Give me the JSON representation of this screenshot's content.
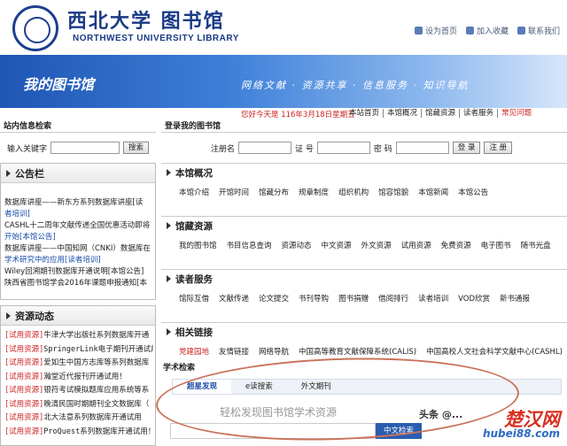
{
  "header": {
    "logo_cn": "西北大学 图书馆",
    "logo_en": "NORTHWEST UNIVERSITY LIBRARY",
    "top_links": [
      "设为首页",
      "加入收藏",
      "联系我们"
    ]
  },
  "banner": {
    "title": "我的图书馆",
    "slogan": "网络文献 · 资源共享 · 信息服务 · 知识导航"
  },
  "topnav": {
    "date": "您好今天是 116年3月18日星期五",
    "items": [
      "本站首页",
      "本馆概况",
      "馆藏资源",
      "读者服务",
      "常见问题"
    ]
  },
  "site_search": {
    "title": "站内信息检索",
    "label": "输入关键字",
    "button": "搜索"
  },
  "notice": {
    "title": "公告栏",
    "items": [
      "数据库讲座——新东方系列数据库讲座[读",
      "者培训]",
      "CASHL十二周年文献传递全国优惠活动即将",
      "开始[本馆公告]",
      "数据库讲座——中国知网（CNKI）数据库在",
      "学术研究中的应用[读者培训]",
      "Wiley回溯期刊数据库开通说明[本馆公告]",
      "陕西省图书馆学会2016年课题申报通知[本"
    ]
  },
  "resources": {
    "title": "资源动态",
    "tag": "[试用资源]",
    "items": [
      "牛津大学出版社系列数据库开通",
      "SpringerLink电子期刊开通试用",
      "爱如生中国方志库等系列数据库",
      "瀚堂近代报刊开通试用！",
      "银符考试模拟题库应用系统等系",
      "晚清民国时期期刊全文数据库（",
      "北大法意系列数据库开通试用",
      "ProQuest系列数据库开通试用！"
    ]
  },
  "login": {
    "title": "登录我的图书馆",
    "username": "注册名",
    "id": "证  号",
    "password": "密  码",
    "login_btn": "登 录",
    "register_btn": "注 册"
  },
  "sections": [
    {
      "title": "本馆概况",
      "items": [
        "本馆介绍",
        "开馆时间",
        "馆藏分布",
        "规章制度",
        "组织机构",
        "馆容馆貌",
        "本馆新闻",
        "本馆公告"
      ]
    },
    {
      "title": "馆藏资源",
      "items": [
        "我的图书馆",
        "书目信息查询",
        "资源动态",
        "中文资源",
        "外文资源",
        "试用资源",
        "免费资源",
        "电子图书",
        "随书光盘"
      ]
    },
    {
      "title": "读者服务",
      "items": [
        "馆际互借",
        "文献传递",
        "论文提交",
        "书刊导购",
        "图书捐赠",
        "借阅排行",
        "读者培训",
        "VOD欣赏",
        "新书通报"
      ]
    },
    {
      "title": "相关链接",
      "items": [
        "党建园地",
        "友情链接",
        "网络导航",
        "中国高等教育文献保障系统(CALIS)",
        "中国高校人文社会科学文献中心(CASHL)"
      ]
    }
  ],
  "scholar": {
    "label": "学术检索",
    "tabs": [
      "超星发现",
      "e读搜索",
      "外文期刊"
    ],
    "hint": "轻松发现图书馆学术资源",
    "button": "中文检索"
  },
  "watermark": {
    "text": "头条 @...",
    "brand": "楚汉网",
    "url": "hubei88.com"
  },
  "colors": {
    "banner": "#2a64c2",
    "accent_red": "#c22222",
    "link_blue": "#1a4ca8",
    "oval": "#c9735b"
  }
}
